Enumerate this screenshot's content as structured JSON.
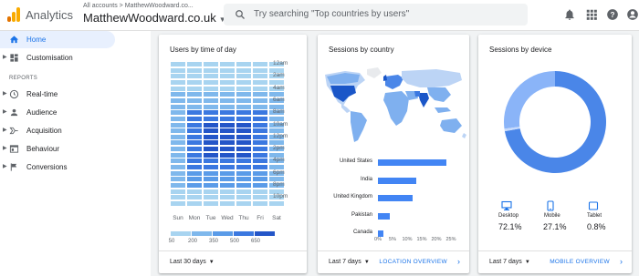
{
  "header": {
    "app_title": "Analytics",
    "breadcrumb": "All accounts > MatthewWoodward.co...",
    "property": "MatthewWoodward.co.uk",
    "search_placeholder": "Try searching \"Top countries by users\"",
    "icons": [
      "notifications-icon",
      "apps-grid-icon",
      "help-icon",
      "account-avatar-icon"
    ]
  },
  "sidebar": {
    "items_top": [
      {
        "label": "Home",
        "icon": "home-icon",
        "active": true
      },
      {
        "label": "Customisation",
        "icon": "dashboard-icon",
        "active": false
      }
    ],
    "section_label": "REPORTS",
    "items_reports": [
      {
        "label": "Real-time",
        "icon": "clock-icon"
      },
      {
        "label": "Audience",
        "icon": "person-icon"
      },
      {
        "label": "Acquisition",
        "icon": "acquisition-icon"
      },
      {
        "label": "Behaviour",
        "icon": "behaviour-icon"
      },
      {
        "label": "Conversions",
        "icon": "flag-icon"
      }
    ]
  },
  "cards": {
    "time_of_day": {
      "title": "Users by time of day",
      "period": "Last 30 days",
      "days": [
        "Sun",
        "Mon",
        "Tue",
        "Wed",
        "Thu",
        "Fri",
        "Sat"
      ],
      "times": [
        "12am",
        "2am",
        "4am",
        "6am",
        "8am",
        "10am",
        "12pm",
        "2pm",
        "4pm",
        "6pm",
        "8pm",
        "10pm"
      ],
      "legend": [
        "50",
        "200",
        "350",
        "500",
        "650"
      ]
    },
    "country": {
      "title": "Sessions by country",
      "period": "Last 7 days",
      "link": "LOCATION OVERVIEW",
      "x_ticks": [
        "0%",
        "5%",
        "10%",
        "15%",
        "20%",
        "25%"
      ]
    },
    "device": {
      "title": "Sessions by device",
      "period": "Last 7 days",
      "link": "MOBILE OVERVIEW",
      "devices": [
        {
          "label": "Desktop",
          "value": "72.1%",
          "icon": "desktop-icon"
        },
        {
          "label": "Mobile",
          "value": "27.1%",
          "icon": "mobile-icon"
        },
        {
          "label": "Tablet",
          "value": "0.8%",
          "icon": "tablet-icon"
        }
      ]
    }
  },
  "chart_data": [
    {
      "type": "heatmap",
      "title": "Users by time of day",
      "x": [
        "Sun",
        "Mon",
        "Tue",
        "Wed",
        "Thu",
        "Fri",
        "Sat"
      ],
      "color_scale": [
        50,
        200,
        350,
        500,
        650
      ]
    },
    {
      "type": "bar",
      "title": "Sessions by country",
      "categories": [
        "United States",
        "India",
        "United Kingdom",
        "Pakistan",
        "Canada"
      ],
      "values": [
        23.5,
        13,
        12,
        4,
        2
      ],
      "xlim": [
        0,
        25
      ]
    },
    {
      "type": "pie",
      "title": "Sessions by device",
      "categories": [
        "Desktop",
        "Mobile",
        "Tablet"
      ],
      "values": [
        72.1,
        27.1,
        0.8
      ]
    }
  ],
  "colors": {
    "accent": "#1a73e8",
    "bar": "#4285f4",
    "heat": [
      "#a8d4f0",
      "#7fb8ec",
      "#5a9be8",
      "#3b78e0",
      "#2456c8"
    ]
  }
}
